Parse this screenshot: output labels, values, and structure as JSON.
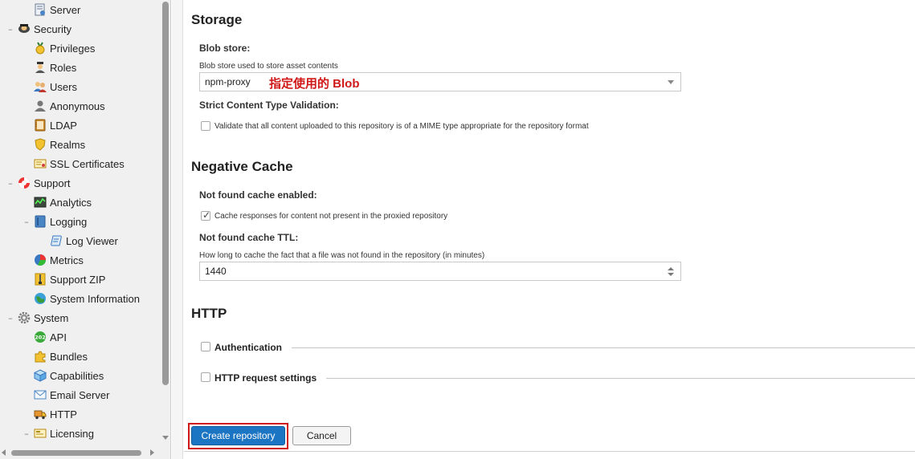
{
  "colors": {
    "accent": "#1c75c2",
    "annotation": "#d01818",
    "highlight_outline": "#d01818"
  },
  "sidebar": {
    "items": [
      {
        "label": "Server",
        "icon": "server-config-icon",
        "level": 2,
        "toggle": ""
      },
      {
        "label": "Security",
        "icon": "security-badge-icon",
        "level": 1,
        "toggle": "–"
      },
      {
        "label": "Privileges",
        "icon": "medal-icon",
        "level": 2,
        "toggle": ""
      },
      {
        "label": "Roles",
        "icon": "user-role-icon",
        "level": 2,
        "toggle": ""
      },
      {
        "label": "Users",
        "icon": "users-icon",
        "level": 2,
        "toggle": ""
      },
      {
        "label": "Anonymous",
        "icon": "anonymous-user-icon",
        "level": 2,
        "toggle": ""
      },
      {
        "label": "LDAP",
        "icon": "address-book-icon",
        "level": 2,
        "toggle": ""
      },
      {
        "label": "Realms",
        "icon": "shield-icon",
        "level": 2,
        "toggle": ""
      },
      {
        "label": "SSL Certificates",
        "icon": "certificate-icon",
        "level": 2,
        "toggle": ""
      },
      {
        "label": "Support",
        "icon": "lifebuoy-icon",
        "level": 1,
        "toggle": "–"
      },
      {
        "label": "Analytics",
        "icon": "analytics-chart-icon",
        "level": 2,
        "toggle": ""
      },
      {
        "label": "Logging",
        "icon": "book-icon",
        "level": 2,
        "toggle": "–"
      },
      {
        "label": "Log Viewer",
        "icon": "scroll-icon",
        "level": 3,
        "toggle": ""
      },
      {
        "label": "Metrics",
        "icon": "pie-chart-icon",
        "level": 2,
        "toggle": ""
      },
      {
        "label": "Support ZIP",
        "icon": "zip-icon",
        "level": 2,
        "toggle": ""
      },
      {
        "label": "System Information",
        "icon": "globe-icon",
        "level": 2,
        "toggle": ""
      },
      {
        "label": "System",
        "icon": "gear-icon",
        "level": 1,
        "toggle": "–"
      },
      {
        "label": "API",
        "icon": "api-icon",
        "level": 2,
        "toggle": ""
      },
      {
        "label": "Bundles",
        "icon": "puzzle-icon",
        "level": 2,
        "toggle": ""
      },
      {
        "label": "Capabilities",
        "icon": "cube-icon",
        "level": 2,
        "toggle": ""
      },
      {
        "label": "Email Server",
        "icon": "envelope-icon",
        "level": 2,
        "toggle": ""
      },
      {
        "label": "HTTP",
        "icon": "truck-icon",
        "level": 2,
        "toggle": ""
      },
      {
        "label": "Licensing",
        "icon": "license-icon",
        "level": 2,
        "toggle": "–"
      }
    ]
  },
  "form": {
    "storage": {
      "title": "Storage",
      "blob_store_label": "Blob store:",
      "blob_store_help": "Blob store used to store asset contents",
      "blob_store_value": "npm-proxy",
      "annotation": "指定使用的 Blob",
      "strict_label": "Strict Content Type Validation:",
      "strict_checkbox_label": "Validate that all content uploaded to this repository is of a MIME type appropriate for the repository format",
      "strict_checked": false
    },
    "negative_cache": {
      "title": "Negative Cache",
      "enabled_label": "Not found cache enabled:",
      "enabled_checkbox_label": "Cache responses for content not present in the proxied repository",
      "enabled_checked": true,
      "ttl_label": "Not found cache TTL:",
      "ttl_help": "How long to cache the fact that a file was not found in the repository (in minutes)",
      "ttl_value": "1440"
    },
    "http": {
      "title": "HTTP",
      "authentication_label": "Authentication",
      "request_settings_label": "HTTP request settings"
    },
    "buttons": {
      "create_label": "Create repository",
      "cancel_label": "Cancel"
    }
  }
}
